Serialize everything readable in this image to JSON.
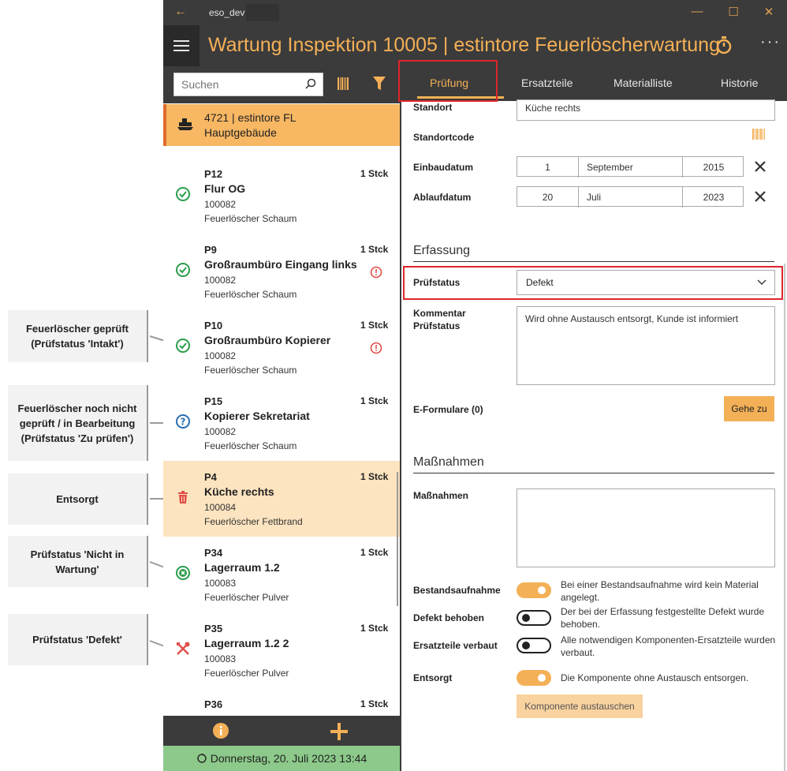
{
  "annotations": [
    {
      "text": "Feuerlöscher geprüft (Prüfstatus 'Intakt')"
    },
    {
      "text": "Feuerlöscher noch nicht geprüft / in Bearbeitung (Prüfstatus 'Zu prüfen')"
    },
    {
      "text": "Entsorgt"
    },
    {
      "text": "Prüfstatus 'Nicht in Wartung'"
    },
    {
      "text": "Prüfstatus 'Defekt'"
    }
  ],
  "titlebar": {
    "app_name": "eso_dev",
    "minimize": "—",
    "maximize": "☐",
    "close": "✕"
  },
  "appbar": {
    "title": "Wartung Inspektion 10005  |  estintore Feuerlöscherwartung",
    "more": "···"
  },
  "search": {
    "placeholder": "Suchen"
  },
  "location": {
    "line1": "4721  |  estintore FL",
    "line2": "Hauptgebäude"
  },
  "items": [
    {
      "code": "P12",
      "name": "Flur OG",
      "number": "100082",
      "type": "Feuerlöscher Schaum",
      "qty": "1 Stck",
      "status": "intakt",
      "warning": false
    },
    {
      "code": "P9",
      "name": "Großraumbüro Eingang links",
      "number": "100082",
      "type": "Feuerlöscher Schaum",
      "qty": "1 Stck",
      "status": "intakt",
      "warning": true
    },
    {
      "code": "P10",
      "name": "Großraumbüro Kopierer",
      "number": "100082",
      "type": "Feuerlöscher Schaum",
      "qty": "1 Stck",
      "status": "intakt",
      "warning": true
    },
    {
      "code": "P15",
      "name": "Kopierer Sekretariat",
      "number": "100082",
      "type": "Feuerlöscher Schaum",
      "qty": "1 Stck",
      "status": "zu-pruefen",
      "warning": false
    },
    {
      "code": "P4",
      "name": "Küche rechts",
      "number": "100084",
      "type": "Feuerlöscher Fettbrand",
      "qty": "1 Stck",
      "status": "entsorgt",
      "warning": false
    },
    {
      "code": "P34",
      "name": "Lagerraum 1.2",
      "number": "100083",
      "type": "Feuerlöscher Pulver",
      "qty": "1 Stck",
      "status": "nicht-in-wartung",
      "warning": false
    },
    {
      "code": "P35",
      "name": "Lagerraum 1.2 2",
      "number": "100083",
      "type": "Feuerlöscher Pulver",
      "qty": "1 Stck",
      "status": "defekt",
      "warning": false
    },
    {
      "code": "P36",
      "name": "",
      "number": "",
      "type": "",
      "qty": "1 Stck",
      "status": "",
      "warning": false
    }
  ],
  "statusbar": {
    "text": "Donnerstag, 20. Juli 2023 13:44"
  },
  "tabs": {
    "t1": "Prüfung",
    "t2": "Ersatzteile",
    "t3": "Materialliste",
    "t4": "Historie"
  },
  "form": {
    "standort_label": "Standort",
    "standort_value": "Küche rechts",
    "standortcode_label": "Standortcode",
    "einbau_label": "Einbaudatum",
    "einbau_day": "1",
    "einbau_month": "September",
    "einbau_year": "2015",
    "ablauf_label": "Ablaufdatum",
    "ablauf_day": "20",
    "ablauf_month": "Juli",
    "ablauf_year": "2023",
    "erfassung_heading": "Erfassung",
    "pruefstatus_label": "Prüfstatus",
    "pruefstatus_value": "Defekt",
    "kommentar_label": "Kommentar Prüfstatus",
    "kommentar_value": "Wird ohne Austausch entsorgt, Kunde ist informiert",
    "eformulare_label": "E-Formulare (0)",
    "gehe_zu": "Gehe zu",
    "massnahmen_heading": "Maßnahmen",
    "massnahmen_label": "Maßnahmen",
    "massnahmen_value": "",
    "bestand_label": "Bestandsaufnahme",
    "bestand_desc": "Bei einer Bestandsaufnahme wird kein Material angelegt.",
    "bestand_on": true,
    "defekt_label": "Defekt behoben",
    "defekt_desc": "Der bei der Erfassung festgestellte Defekt wurde behoben.",
    "defekt_on": false,
    "ersatz_label": "Ersatzteile verbaut",
    "ersatz_desc": "Alle notwendigen Komponenten-Ersatzteile wurden verbaut.",
    "ersatz_on": false,
    "entsorgt_label": "Entsorgt",
    "entsorgt_desc": "Die Komponente ohne Austausch entsorgen.",
    "entsorgt_on": true,
    "austauschen_btn": "Komponente austauschen"
  },
  "colors": {
    "accent": "#f4b056",
    "dark": "#3b3b3b",
    "green": "#2a9d4b",
    "red": "#e0504a",
    "blue": "#2a6fb0",
    "highlight": "#e0252b"
  }
}
